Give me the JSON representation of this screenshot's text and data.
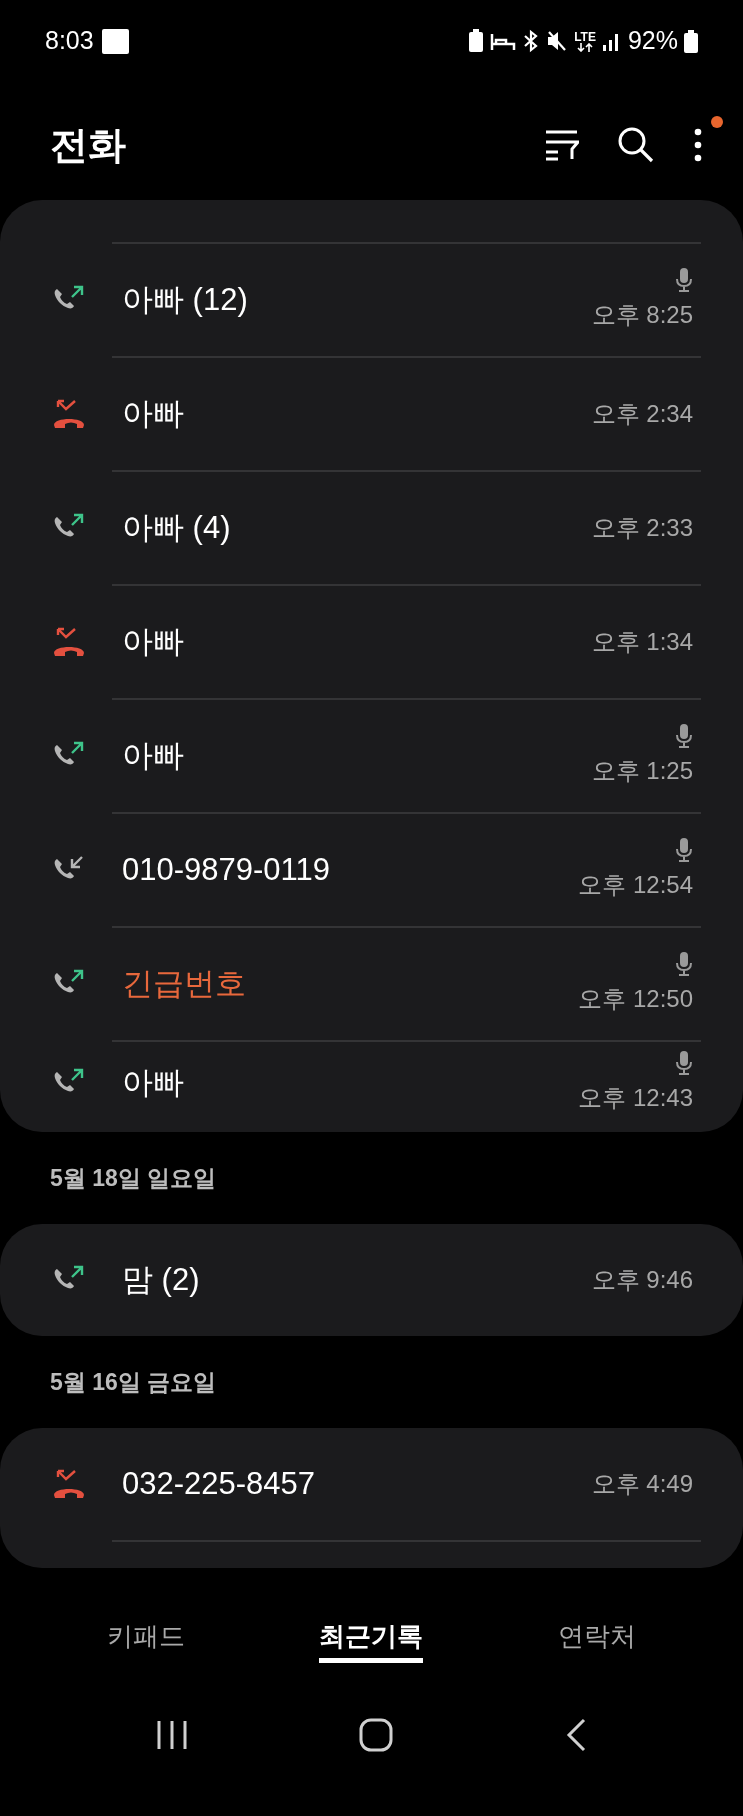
{
  "status_bar": {
    "time": "8:03",
    "network": "LTE",
    "battery": "92%"
  },
  "header": {
    "title": "전화",
    "menu_badge": true
  },
  "groups": [
    {
      "calls": [
        {
          "kind": "outgoing",
          "name": "아빠 (12)",
          "time": "오후 8:25",
          "recorded": true,
          "emergency": false
        },
        {
          "kind": "missed",
          "name": "아빠",
          "time": "오후 2:34",
          "recorded": false,
          "emergency": false
        },
        {
          "kind": "outgoing",
          "name": "아빠 (4)",
          "time": "오후 2:33",
          "recorded": false,
          "emergency": false
        },
        {
          "kind": "missed",
          "name": "아빠",
          "time": "오후 1:34",
          "recorded": false,
          "emergency": false
        },
        {
          "kind": "outgoing",
          "name": "아빠",
          "time": "오후 1:25",
          "recorded": true,
          "emergency": false
        },
        {
          "kind": "incoming",
          "name": "010-9879-0119",
          "time": "오후 12:54",
          "recorded": true,
          "emergency": false
        },
        {
          "kind": "outgoing",
          "name": "긴급번호",
          "time": "오후 12:50",
          "recorded": true,
          "emergency": true
        },
        {
          "kind": "outgoing",
          "name": "아빠",
          "time": "오후 12:43",
          "recorded": true,
          "emergency": false
        }
      ]
    },
    {
      "date": "5월 18일 일요일",
      "calls": [
        {
          "kind": "outgoing",
          "name": "맘 (2)",
          "time": "오후 9:46",
          "recorded": false,
          "emergency": false
        }
      ]
    },
    {
      "date": "5월 16일 금요일",
      "calls": [
        {
          "kind": "missed",
          "name": "032-225-8457",
          "time": "오후 4:49",
          "recorded": false,
          "emergency": false
        }
      ]
    }
  ],
  "tabs": [
    {
      "label": "키패드",
      "selected": false
    },
    {
      "label": "최근기록",
      "selected": true
    },
    {
      "label": "연락처",
      "selected": false
    }
  ]
}
